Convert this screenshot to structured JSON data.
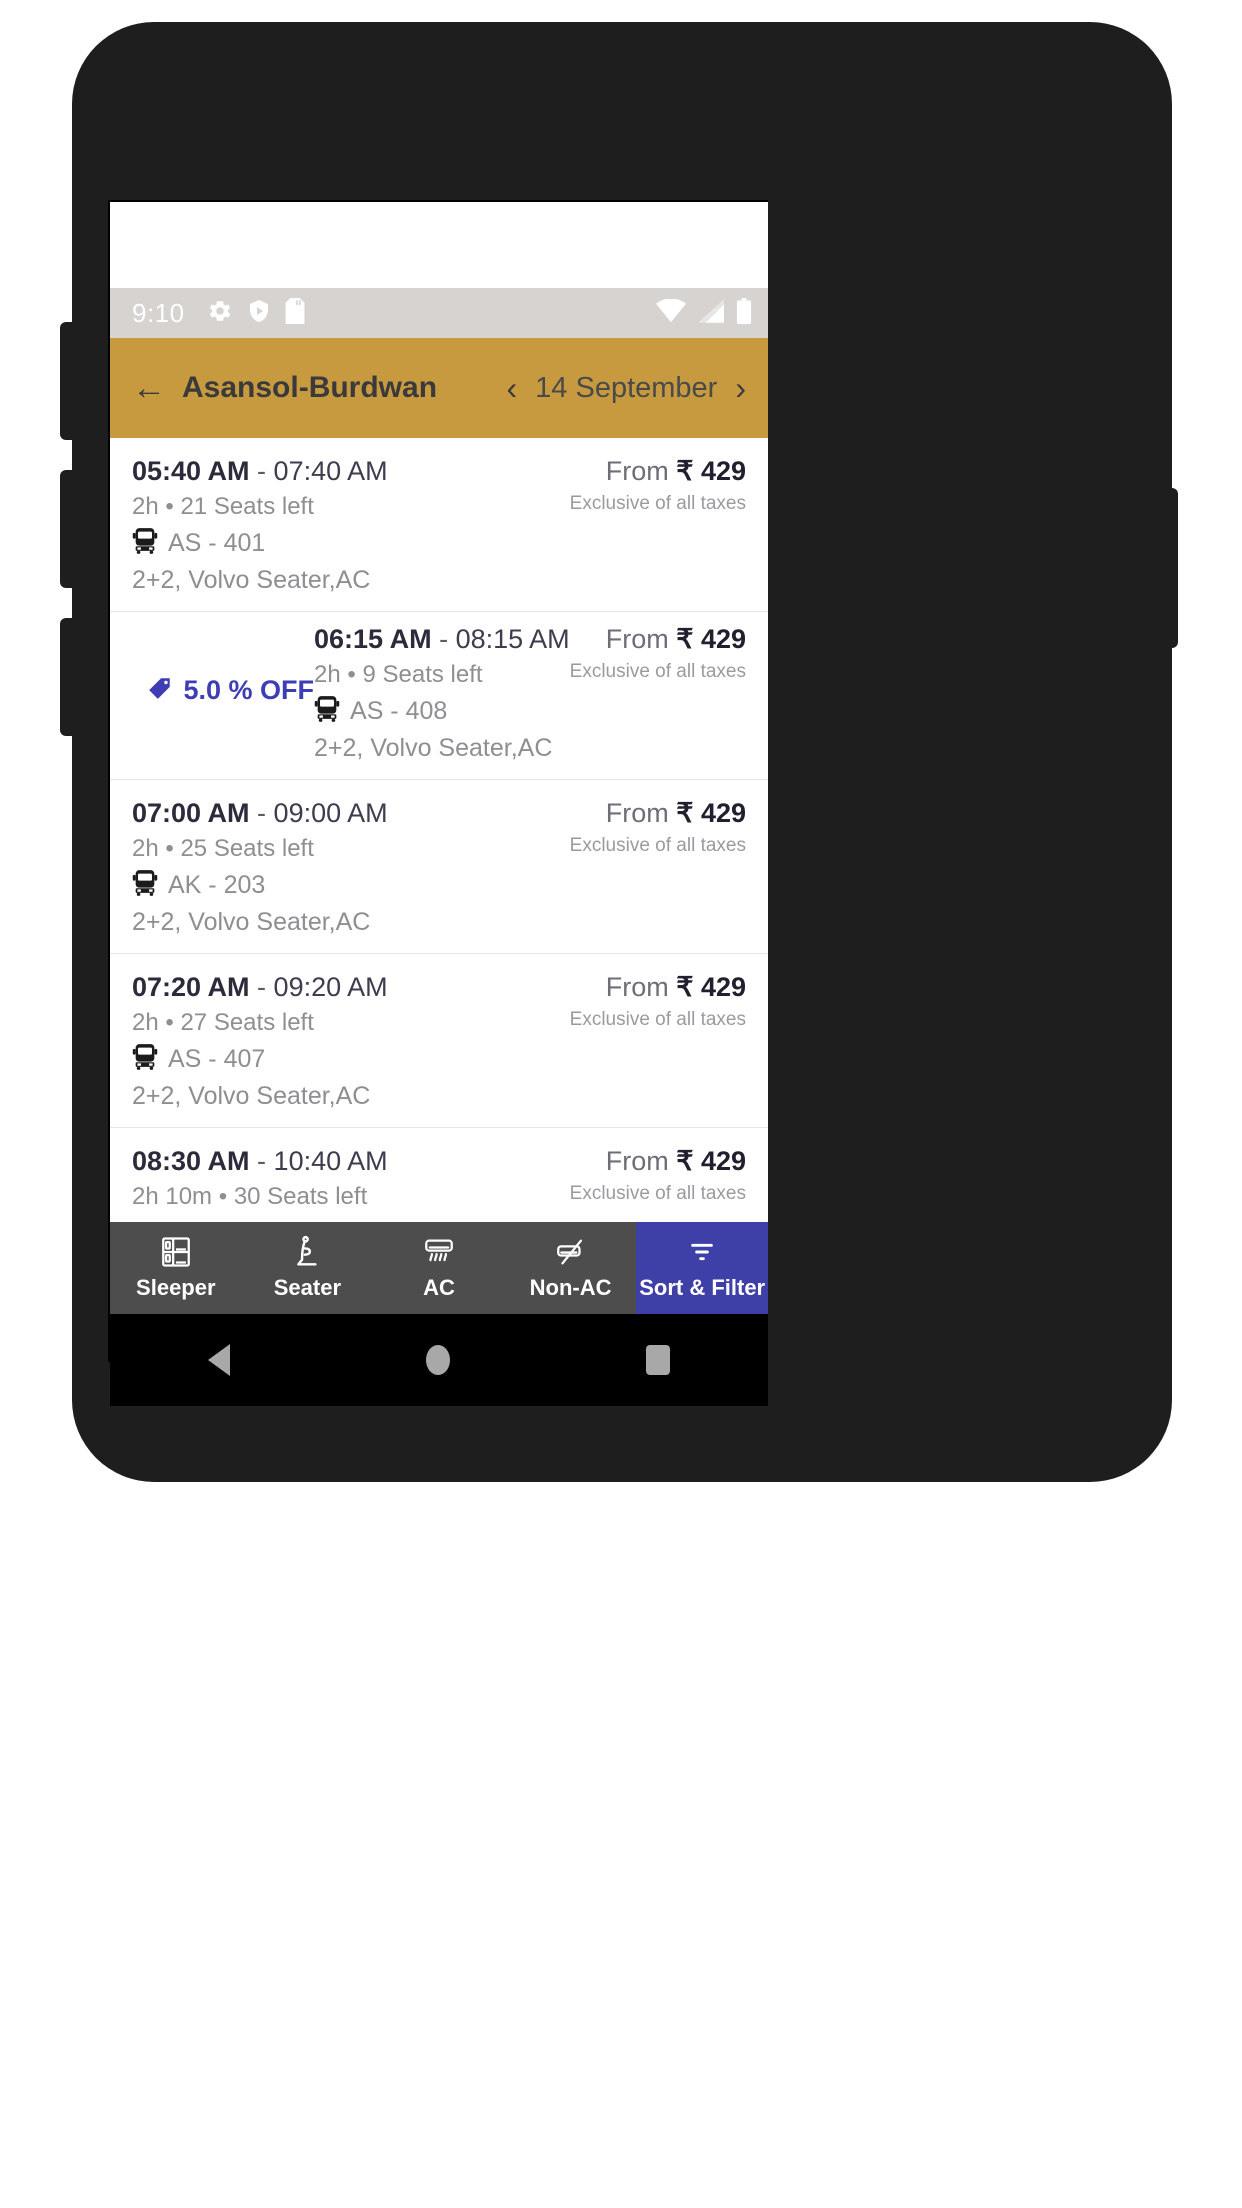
{
  "statusbar": {
    "time": "9:10",
    "left_icons": [
      "gear-icon",
      "play-protect-icon",
      "sdcard-icon"
    ],
    "right_icons": [
      "wifi-icon",
      "cellular-signal-icon",
      "battery-icon"
    ]
  },
  "header": {
    "back_icon": "←",
    "route": "Asansol-Burdwan",
    "prev_icon": "‹",
    "date": "14 September",
    "next_icon": "›",
    "bg_color": "#c79a3f"
  },
  "buses": [
    {
      "offer": null,
      "depart": "05:40 AM",
      "dash": " - ",
      "arrive": "07:40 AM",
      "duration": "2h",
      "dot": "•",
      "seats": "21 Seats left",
      "bus_no": "AS - 401",
      "bus_type": "2+2, Volvo Seater,AC",
      "price_prefix": "From ",
      "price": "₹ 429",
      "tax_note": "Exclusive of all taxes"
    },
    {
      "offer": "5.0 % OFF",
      "depart": "06:15 AM",
      "dash": " - ",
      "arrive": "08:15 AM",
      "duration": "2h",
      "dot": "•",
      "seats": "9 Seats left",
      "bus_no": "AS - 408",
      "bus_type": "2+2, Volvo Seater,AC",
      "price_prefix": "From ",
      "price": "₹ 429",
      "tax_note": "Exclusive of all taxes"
    },
    {
      "offer": null,
      "depart": "07:00 AM",
      "dash": " - ",
      "arrive": "09:00 AM",
      "duration": "2h",
      "dot": "•",
      "seats": "25 Seats left",
      "bus_no": "AK - 203",
      "bus_type": "2+2, Volvo Seater,AC",
      "price_prefix": "From ",
      "price": "₹ 429",
      "tax_note": "Exclusive of all taxes"
    },
    {
      "offer": null,
      "depart": "07:20 AM",
      "dash": " - ",
      "arrive": "09:20 AM",
      "duration": "2h",
      "dot": "•",
      "seats": "27 Seats left",
      "bus_no": "AS - 407",
      "bus_type": "2+2, Volvo Seater,AC",
      "price_prefix": "From ",
      "price": "₹ 429",
      "tax_note": "Exclusive of all taxes"
    },
    {
      "offer": null,
      "depart": "08:30 AM",
      "dash": " - ",
      "arrive": "10:40 AM",
      "duration": "2h 10m",
      "dot": "•",
      "seats": "30 Seats left",
      "bus_no": "",
      "bus_type": "",
      "price_prefix": "From ",
      "price": "₹ 429",
      "tax_note": "Exclusive of all taxes"
    }
  ],
  "filterbar": {
    "items": [
      {
        "label": "Sleeper",
        "icon": "sleeper-berth-icon",
        "active": false
      },
      {
        "label": "Seater",
        "icon": "seat-icon",
        "active": false
      },
      {
        "label": "AC",
        "icon": "air-conditioner-icon",
        "active": false
      },
      {
        "label": "Non-AC",
        "icon": "no-air-conditioner-icon",
        "active": false
      },
      {
        "label": "Sort & Filter",
        "icon": "filter-funnel-icon",
        "active": true
      }
    ],
    "accent_color": "#3f3fa8",
    "bg_color": "#4d4d4d"
  },
  "navbar": {
    "back": "back-triangle-icon",
    "home": "home-circle-icon",
    "recents": "recents-square-icon"
  }
}
